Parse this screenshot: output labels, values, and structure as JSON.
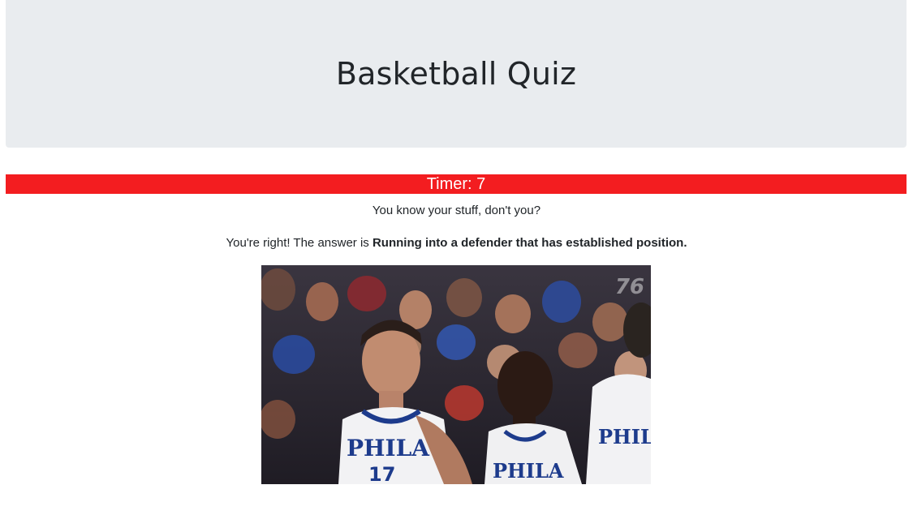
{
  "header": {
    "title": "Basketball Quiz"
  },
  "timer": {
    "label": "Timer: 7",
    "color": "#f31d20"
  },
  "feedback": {
    "praise": "You know your stuff, don't you?",
    "answer_prefix": "You're right! The answer is ",
    "answer": "Running into a defender that has established position."
  },
  "image": {
    "watermark": "76",
    "jersey_text_left": "PHILA",
    "jersey_number_left": "17",
    "jersey_text_mid": "PHILA",
    "jersey_text_right": "PHILA"
  }
}
